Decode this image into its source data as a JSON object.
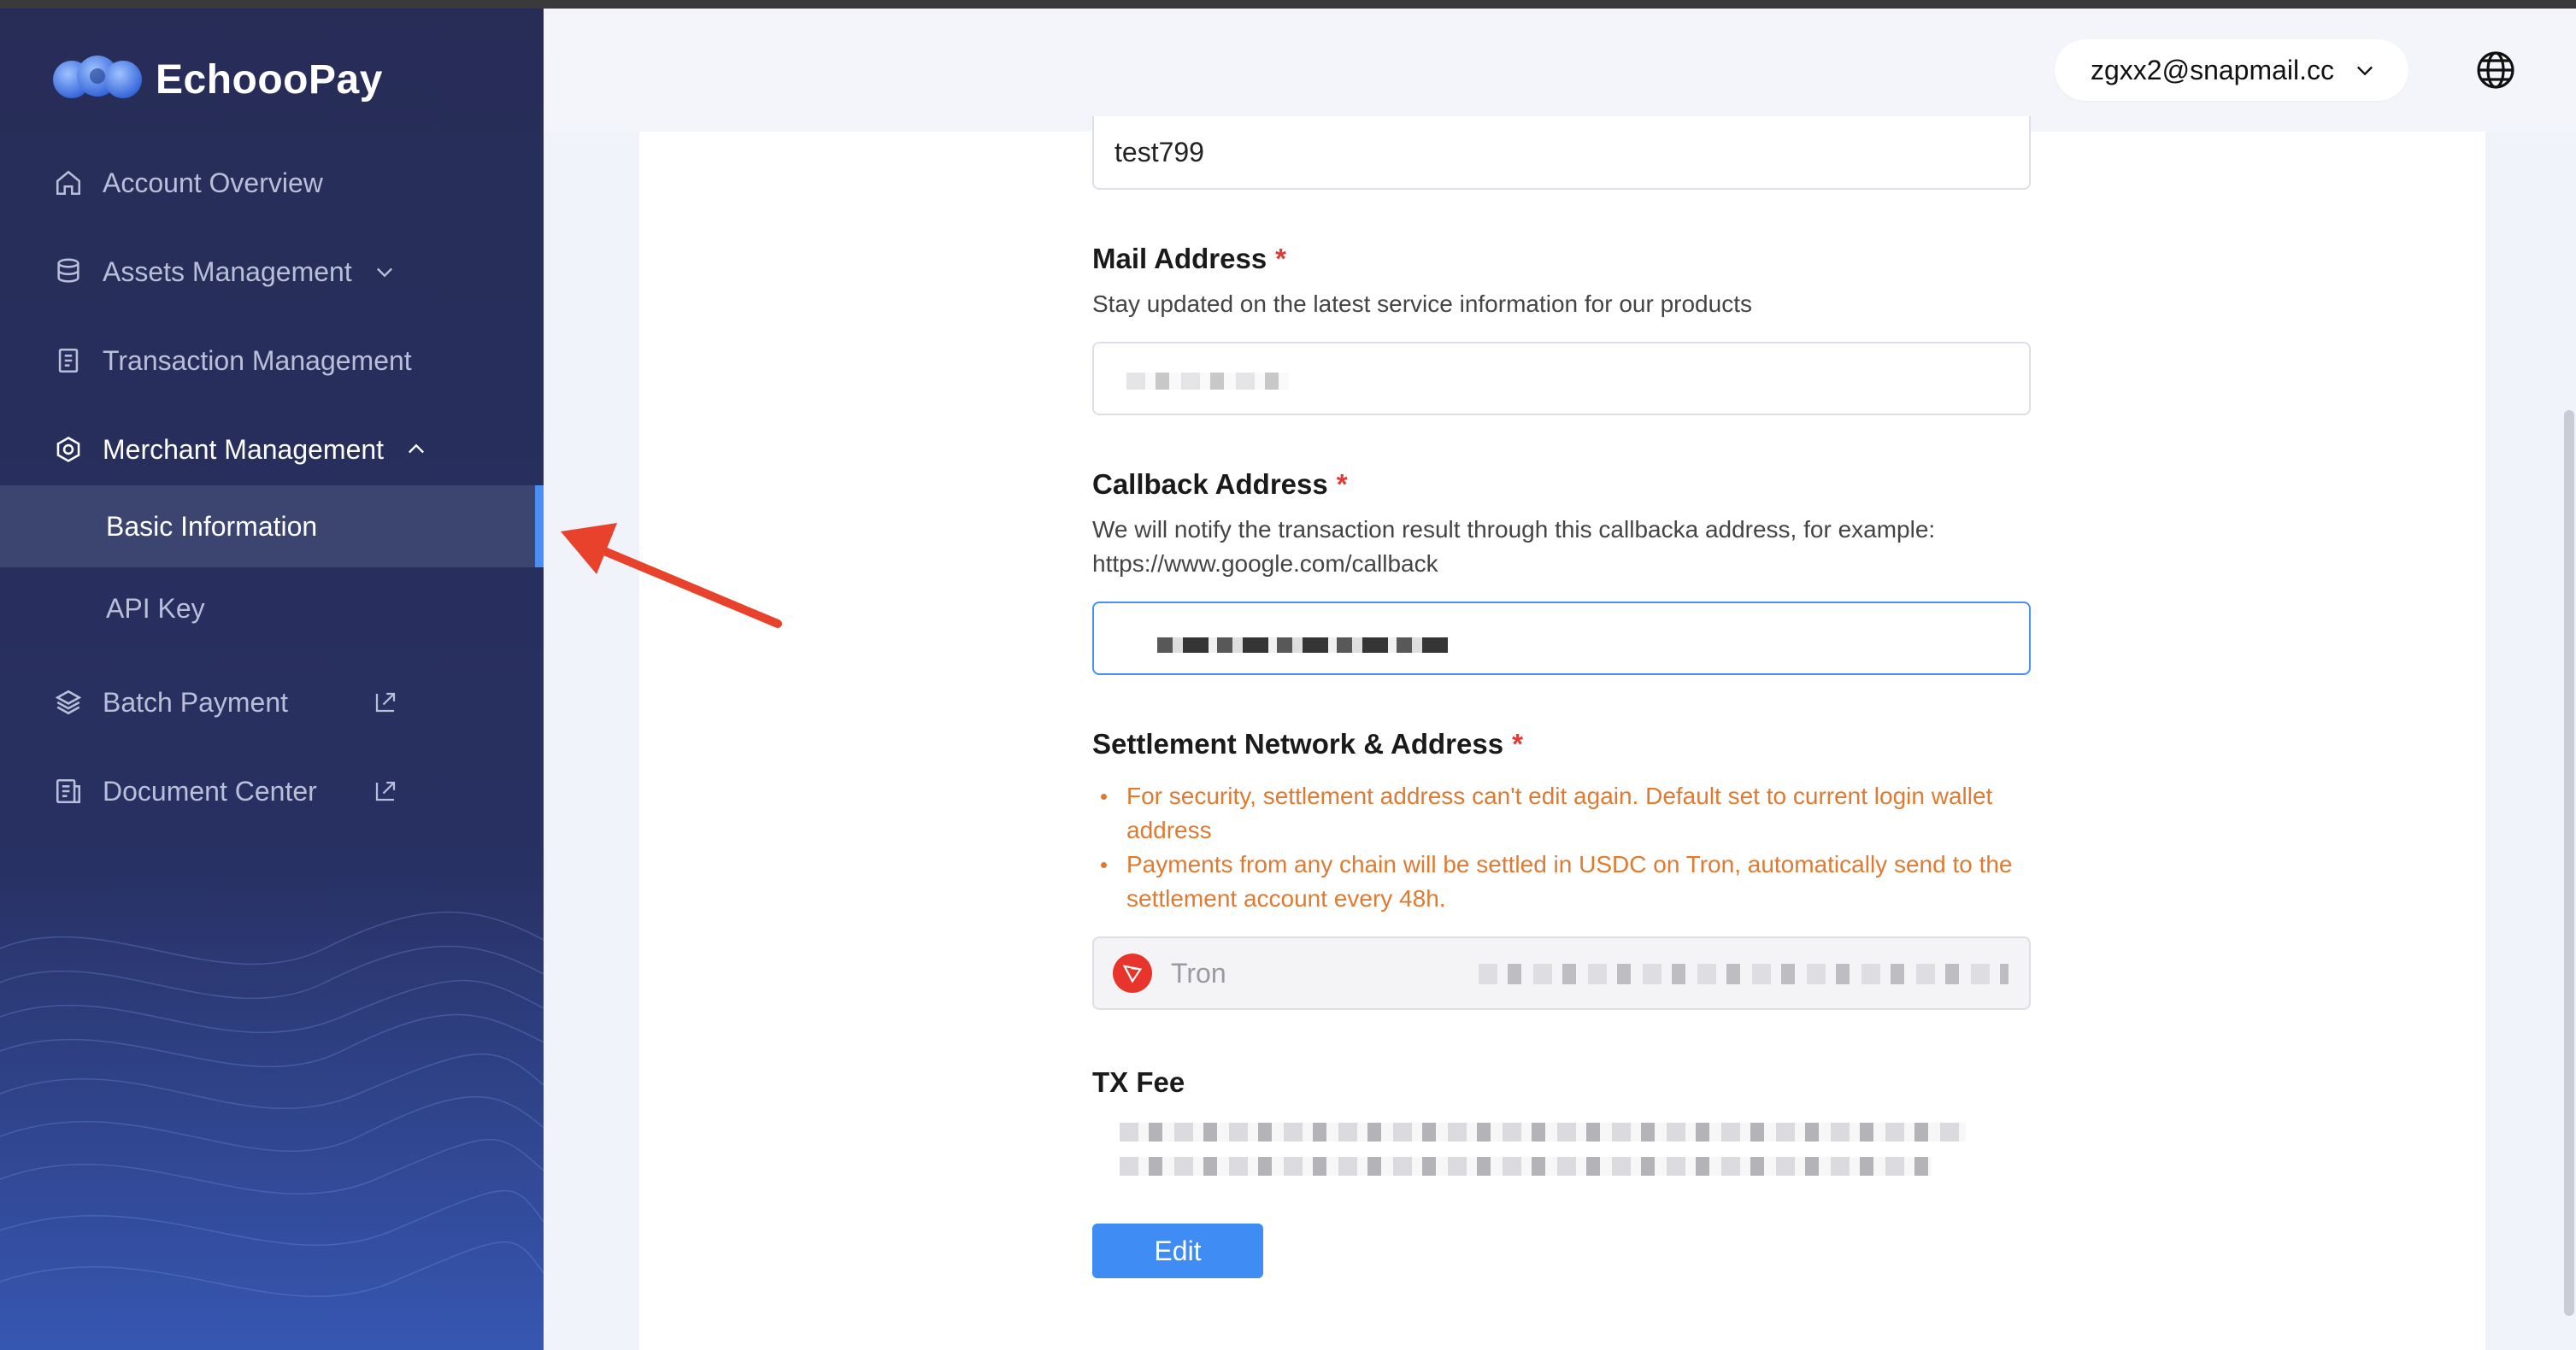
{
  "app": {
    "brand_name": "EchoooPay"
  },
  "sidebar": {
    "items": [
      {
        "label": "Account Overview",
        "icon": "home-icon"
      },
      {
        "label": "Assets Management",
        "icon": "database-icon",
        "expandable": true,
        "expanded": false
      },
      {
        "label": "Transaction Management",
        "icon": "document-icon"
      },
      {
        "label": "Merchant Management",
        "icon": "gear-hexagon-icon",
        "expandable": true,
        "expanded": true,
        "children": [
          {
            "label": "Basic Information",
            "active": true
          },
          {
            "label": "API Key"
          }
        ]
      },
      {
        "label": "Batch Payment",
        "icon": "layers-icon",
        "external": true
      },
      {
        "label": "Document Center",
        "icon": "document-center-icon",
        "external": true
      }
    ]
  },
  "header": {
    "account_email": "zgxx2@snapmail.cc"
  },
  "form": {
    "name_value": "test799",
    "mail": {
      "label": "Mail Address",
      "required_mark": "*",
      "description": "Stay updated on the latest service information for our products"
    },
    "callback": {
      "label": "Callback Address",
      "required_mark": "*",
      "description_line1": "We will notify the transaction result through this callbacka address, for example:",
      "description_line2": "https://www.google.com/callback"
    },
    "settlement": {
      "label": "Settlement Network & Address",
      "required_mark": "*",
      "notes": [
        "For security, settlement address can't edit again. Default set to current login wallet address",
        "Payments from any chain will be settled in USDC on Tron, automatically send to the settlement account every 48h."
      ],
      "network": "Tron"
    },
    "tx_fee": {
      "label": "TX Fee"
    },
    "edit_button": "Edit"
  },
  "colors": {
    "sidebar_bg": "#272d57",
    "accent": "#3f8cf5",
    "warning": "#e07a30",
    "required": "#e53935",
    "annotation_arrow": "#e8412c"
  }
}
